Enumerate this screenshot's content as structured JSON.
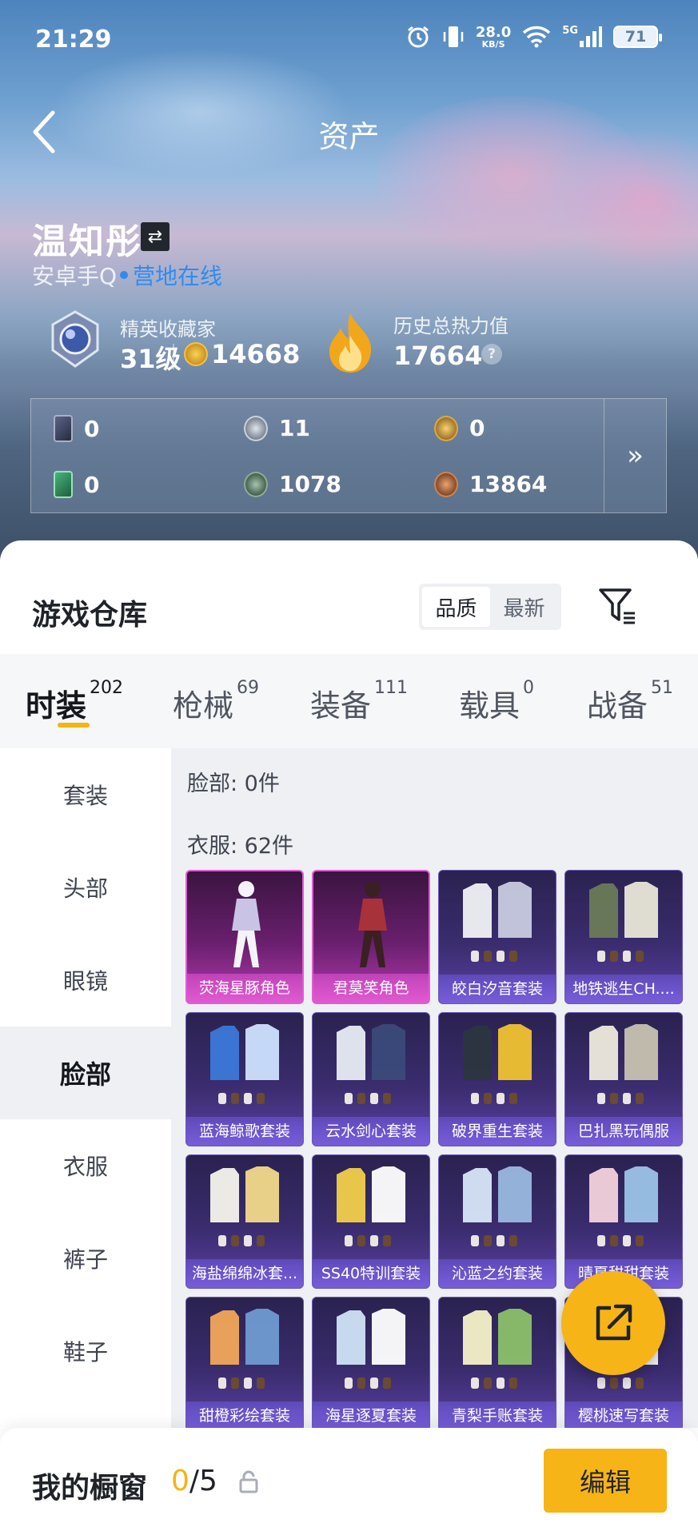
{
  "status": {
    "time": "21:29",
    "speed_value": "28.0",
    "speed_unit": "KB/S",
    "network": "5G",
    "battery": "71"
  },
  "header": {
    "title": "资产"
  },
  "profile": {
    "name": "温知彤",
    "platform": "安卓手Q",
    "online_status": "营地在线",
    "collector_title": "精英收藏家",
    "level": "31级",
    "collector_points": "14668",
    "heat_title": "历史总热力值",
    "heat_value": "17664",
    "help": "?"
  },
  "currencies": [
    {
      "icon": "dark-card-icon",
      "value": "0",
      "color": "#3b4258"
    },
    {
      "icon": "silver-coin-icon",
      "value": "11",
      "color": "#8f9aa8"
    },
    {
      "icon": "gold-emblem-icon",
      "value": "0",
      "color": "#b98a2d"
    },
    {
      "icon": "green-card-icon",
      "value": "0",
      "color": "#2f8f5d"
    },
    {
      "icon": "green-coin-icon",
      "value": "1078",
      "color": "#4d6e58"
    },
    {
      "icon": "bronze-coin-icon",
      "value": "13864",
      "color": "#b06a3a"
    }
  ],
  "expand": "»",
  "warehouse": {
    "title": "游戏仓库",
    "sort_quality": "品质",
    "sort_latest": "最新"
  },
  "tabs": [
    {
      "label": "时装",
      "count": "202"
    },
    {
      "label": "枪械",
      "count": "69"
    },
    {
      "label": "装备",
      "count": "111"
    },
    {
      "label": "载具",
      "count": "0"
    },
    {
      "label": "战备",
      "count": "51"
    }
  ],
  "sidebar": [
    "套装",
    "头部",
    "眼镜",
    "脸部",
    "衣服",
    "裤子",
    "鞋子"
  ],
  "content": {
    "face_label": "脸部: 0件",
    "clothes_label": "衣服: 62件",
    "items": [
      "荧海星豚角色",
      "君莫笑角色",
      "皎白汐音套装",
      "地铁逃生CH....",
      "蓝海鲸歌套装",
      "云水剑心套装",
      "破界重生套装",
      "巴扎黑玩偶服",
      "海盐绵绵冰套...",
      "SS40特训套装",
      "沁蓝之约套装",
      "晴夏甜甜套装",
      "甜橙彩绘套装",
      "海星逐夏套装",
      "青梨手账套装",
      "樱桃速写套装"
    ]
  },
  "bottom": {
    "window_label": "我的橱窗",
    "window_current": "0",
    "window_total": "/5",
    "edit": "编辑"
  },
  "colors": {
    "accent": "#f6b416",
    "link": "#2f8bf0",
    "legend_border": "#e05cd4",
    "epic_card": "#3a2c6e"
  }
}
